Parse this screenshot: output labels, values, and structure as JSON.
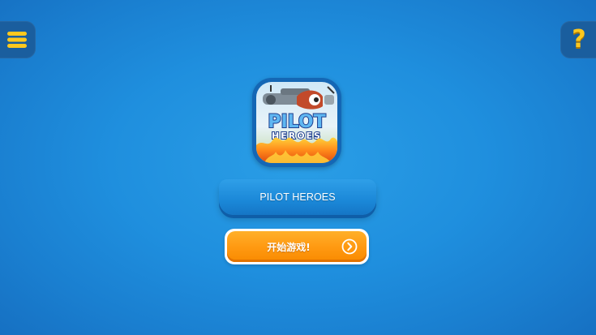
{
  "header": {
    "menu_icon": "hamburger-menu-icon",
    "help_icon": "question-mark-icon",
    "help_glyph": "?"
  },
  "game": {
    "icon_name": "pilot-heroes-game-icon",
    "icon_word_top": "PILOT",
    "icon_word_bottom": "HEROES",
    "title": "PILOT HEROES"
  },
  "actions": {
    "start_label": "开始游戏!",
    "start_icon": "chevron-right-circle-icon"
  },
  "colors": {
    "accent_yellow": "#ffc81e",
    "start_orange": "#ff9a12",
    "background_blue": "#1f8fde"
  }
}
